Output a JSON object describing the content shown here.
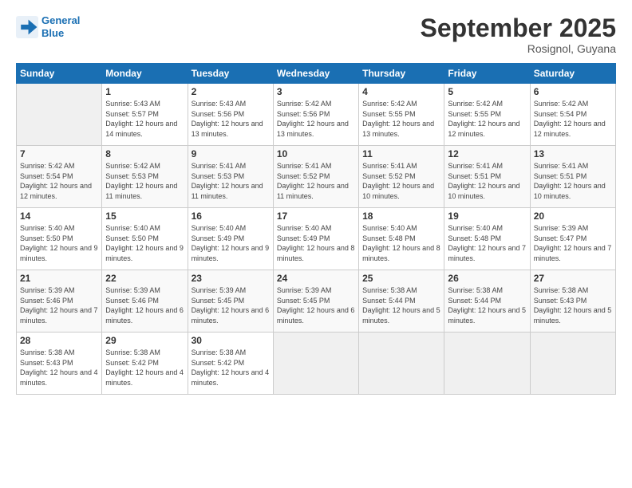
{
  "app": {
    "logo_line1": "General",
    "logo_line2": "Blue"
  },
  "header": {
    "month": "September 2025",
    "location": "Rosignol, Guyana"
  },
  "days_of_week": [
    "Sunday",
    "Monday",
    "Tuesday",
    "Wednesday",
    "Thursday",
    "Friday",
    "Saturday"
  ],
  "weeks": [
    [
      {
        "day": "",
        "empty": true
      },
      {
        "day": "1",
        "sunrise": "5:43 AM",
        "sunset": "5:57 PM",
        "daylight": "12 hours and 14 minutes."
      },
      {
        "day": "2",
        "sunrise": "5:43 AM",
        "sunset": "5:56 PM",
        "daylight": "12 hours and 13 minutes."
      },
      {
        "day": "3",
        "sunrise": "5:42 AM",
        "sunset": "5:56 PM",
        "daylight": "12 hours and 13 minutes."
      },
      {
        "day": "4",
        "sunrise": "5:42 AM",
        "sunset": "5:55 PM",
        "daylight": "12 hours and 13 minutes."
      },
      {
        "day": "5",
        "sunrise": "5:42 AM",
        "sunset": "5:55 PM",
        "daylight": "12 hours and 12 minutes."
      },
      {
        "day": "6",
        "sunrise": "5:42 AM",
        "sunset": "5:54 PM",
        "daylight": "12 hours and 12 minutes."
      }
    ],
    [
      {
        "day": "7",
        "sunrise": "5:42 AM",
        "sunset": "5:54 PM",
        "daylight": "12 hours and 12 minutes."
      },
      {
        "day": "8",
        "sunrise": "5:42 AM",
        "sunset": "5:53 PM",
        "daylight": "12 hours and 11 minutes."
      },
      {
        "day": "9",
        "sunrise": "5:41 AM",
        "sunset": "5:53 PM",
        "daylight": "12 hours and 11 minutes."
      },
      {
        "day": "10",
        "sunrise": "5:41 AM",
        "sunset": "5:52 PM",
        "daylight": "12 hours and 11 minutes."
      },
      {
        "day": "11",
        "sunrise": "5:41 AM",
        "sunset": "5:52 PM",
        "daylight": "12 hours and 10 minutes."
      },
      {
        "day": "12",
        "sunrise": "5:41 AM",
        "sunset": "5:51 PM",
        "daylight": "12 hours and 10 minutes."
      },
      {
        "day": "13",
        "sunrise": "5:41 AM",
        "sunset": "5:51 PM",
        "daylight": "12 hours and 10 minutes."
      }
    ],
    [
      {
        "day": "14",
        "sunrise": "5:40 AM",
        "sunset": "5:50 PM",
        "daylight": "12 hours and 9 minutes."
      },
      {
        "day": "15",
        "sunrise": "5:40 AM",
        "sunset": "5:50 PM",
        "daylight": "12 hours and 9 minutes."
      },
      {
        "day": "16",
        "sunrise": "5:40 AM",
        "sunset": "5:49 PM",
        "daylight": "12 hours and 9 minutes."
      },
      {
        "day": "17",
        "sunrise": "5:40 AM",
        "sunset": "5:49 PM",
        "daylight": "12 hours and 8 minutes."
      },
      {
        "day": "18",
        "sunrise": "5:40 AM",
        "sunset": "5:48 PM",
        "daylight": "12 hours and 8 minutes."
      },
      {
        "day": "19",
        "sunrise": "5:40 AM",
        "sunset": "5:48 PM",
        "daylight": "12 hours and 7 minutes."
      },
      {
        "day": "20",
        "sunrise": "5:39 AM",
        "sunset": "5:47 PM",
        "daylight": "12 hours and 7 minutes."
      }
    ],
    [
      {
        "day": "21",
        "sunrise": "5:39 AM",
        "sunset": "5:46 PM",
        "daylight": "12 hours and 7 minutes."
      },
      {
        "day": "22",
        "sunrise": "5:39 AM",
        "sunset": "5:46 PM",
        "daylight": "12 hours and 6 minutes."
      },
      {
        "day": "23",
        "sunrise": "5:39 AM",
        "sunset": "5:45 PM",
        "daylight": "12 hours and 6 minutes."
      },
      {
        "day": "24",
        "sunrise": "5:39 AM",
        "sunset": "5:45 PM",
        "daylight": "12 hours and 6 minutes."
      },
      {
        "day": "25",
        "sunrise": "5:38 AM",
        "sunset": "5:44 PM",
        "daylight": "12 hours and 5 minutes."
      },
      {
        "day": "26",
        "sunrise": "5:38 AM",
        "sunset": "5:44 PM",
        "daylight": "12 hours and 5 minutes."
      },
      {
        "day": "27",
        "sunrise": "5:38 AM",
        "sunset": "5:43 PM",
        "daylight": "12 hours and 5 minutes."
      }
    ],
    [
      {
        "day": "28",
        "sunrise": "5:38 AM",
        "sunset": "5:43 PM",
        "daylight": "12 hours and 4 minutes."
      },
      {
        "day": "29",
        "sunrise": "5:38 AM",
        "sunset": "5:42 PM",
        "daylight": "12 hours and 4 minutes."
      },
      {
        "day": "30",
        "sunrise": "5:38 AM",
        "sunset": "5:42 PM",
        "daylight": "12 hours and 4 minutes."
      },
      {
        "day": "",
        "empty": true
      },
      {
        "day": "",
        "empty": true
      },
      {
        "day": "",
        "empty": true
      },
      {
        "day": "",
        "empty": true
      }
    ]
  ]
}
